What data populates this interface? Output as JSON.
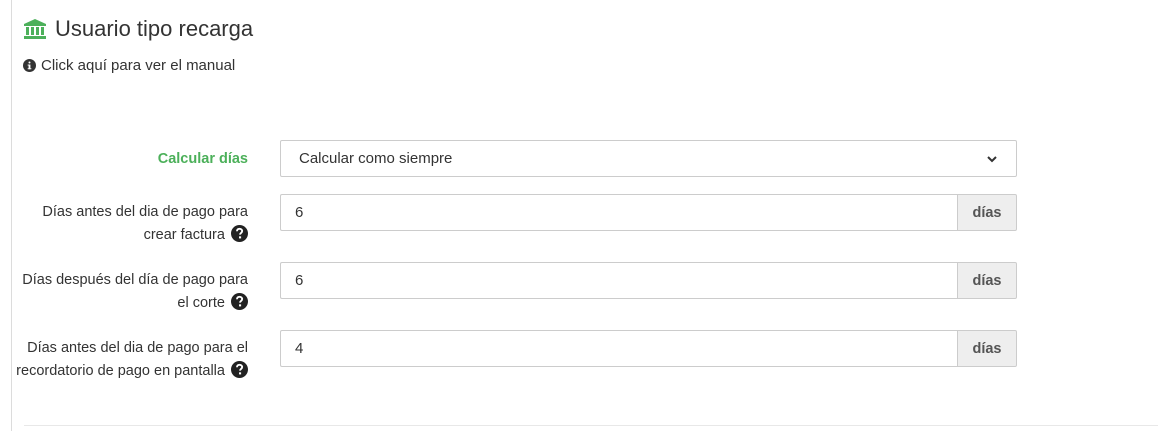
{
  "header": {
    "title": "Usuario tipo recarga",
    "icon": "bank-icon",
    "icon_color": "#4cb05a"
  },
  "manual": {
    "label": "Click aquí para ver el manual",
    "icon": "info-circle-icon"
  },
  "form": {
    "calcular": {
      "label": "Calcular días",
      "selected": "Calcular como siempre"
    },
    "fields": [
      {
        "label": "Días antes del dia de pago para crear factura",
        "value": "6",
        "unit": "días"
      },
      {
        "label": "Días después del día de pago para el corte",
        "value": "6",
        "unit": "días"
      },
      {
        "label": "Días antes del dia de pago para el recordatorio de pago en pantalla",
        "value": "4",
        "unit": "días"
      }
    ]
  },
  "colors": {
    "accent_green": "#4cb05a",
    "addon_bg": "#eeeeee",
    "border": "#cccccc"
  }
}
